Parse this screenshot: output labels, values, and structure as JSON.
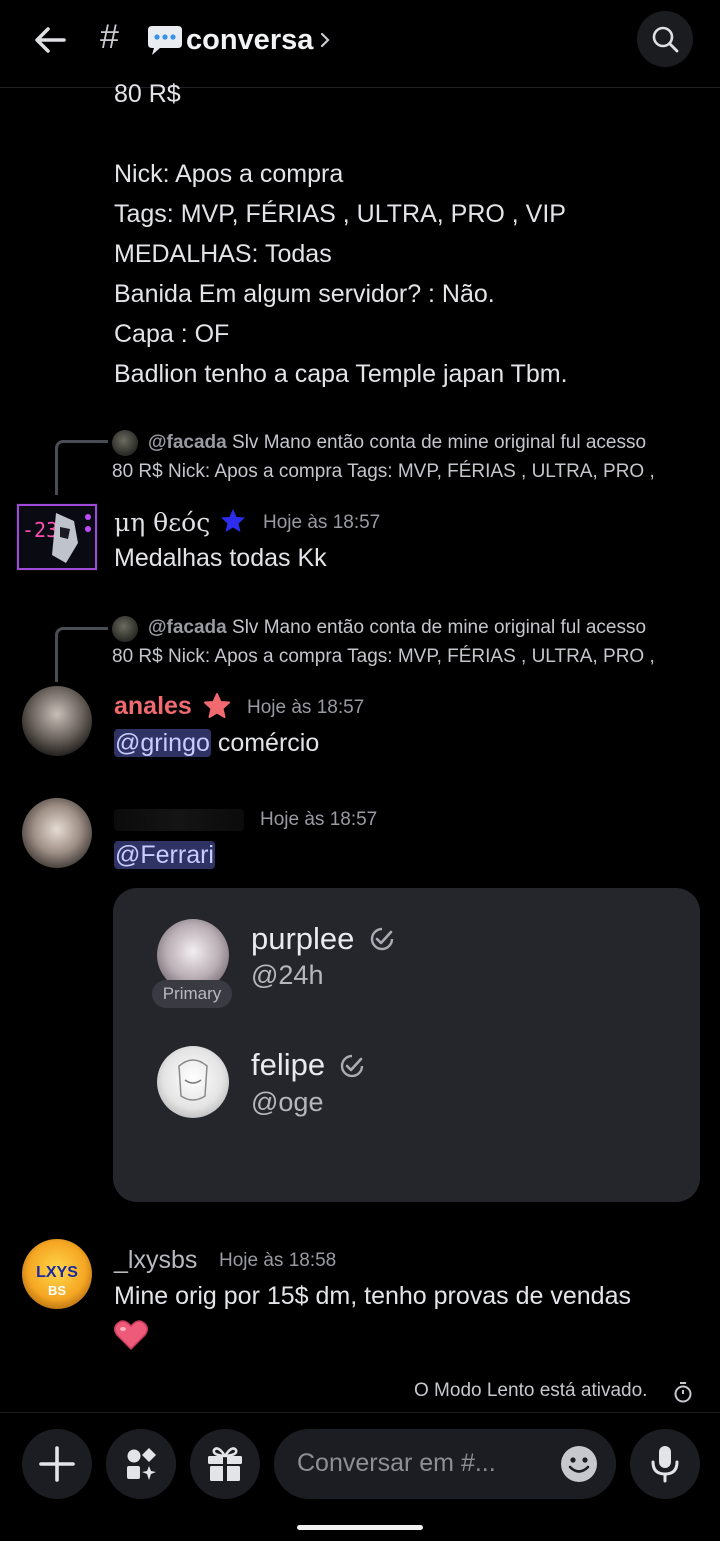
{
  "header": {
    "channel_hash": "#",
    "channel_name": "conversa"
  },
  "message_top": {
    "lines": [
      "80 R$",
      "Nick: Apos a compra",
      "Tags: MVP, FÉRIAS , ULTRA, PRO , VIP",
      "MEDALHAS: Todas",
      "Banida Em algum servidor? : Não.",
      "Capa : OF",
      "Badlion tenho a capa Temple japan Tbm."
    ]
  },
  "reply_1": {
    "author": "@facada",
    "line1": "Slv Mano então conta de mine original ful acesso",
    "line2": "80 R$   Nick: Apos a compra Tags: MVP, FÉRIAS , ULTRA, PRO ,"
  },
  "message_2": {
    "author": "μη θεός",
    "time": "Hoje às 18:57",
    "text": "Medalhas todas Kk",
    "author_color": "#3d3df5"
  },
  "reply_2": {
    "author": "@facada",
    "line1": "Slv Mano então conta de mine original ful acesso",
    "line2": "80 R$   Nick: Apos a compra Tags: MVP, FÉRIAS , ULTRA, PRO ,"
  },
  "message_3": {
    "author": "anales",
    "time": "Hoje às 18:57",
    "mention": "@gringo",
    "text": " comércio",
    "author_color": "#f06a6f"
  },
  "message_4": {
    "time": "Hoje às 18:57",
    "mention": "@Ferrari"
  },
  "accounts_card": {
    "accounts": [
      {
        "name": "purplee",
        "handle": "@24h",
        "badge": "Primary"
      },
      {
        "name": "felipe",
        "handle": "@oge"
      }
    ]
  },
  "message_5": {
    "author": "_lxysbs",
    "time": "Hoje às 18:58",
    "text": "Mine orig por 15$ dm, tenho provas de vendas",
    "avatar_text": "LXYS",
    "avatar_subtext": "BS"
  },
  "slow_mode": {
    "text": "O Modo Lento está ativado."
  },
  "composer": {
    "placeholder": "Conversar em #..."
  },
  "colors": {
    "background": "#000000",
    "mention_bg": "#2f3364",
    "card_bg": "#25262c"
  }
}
